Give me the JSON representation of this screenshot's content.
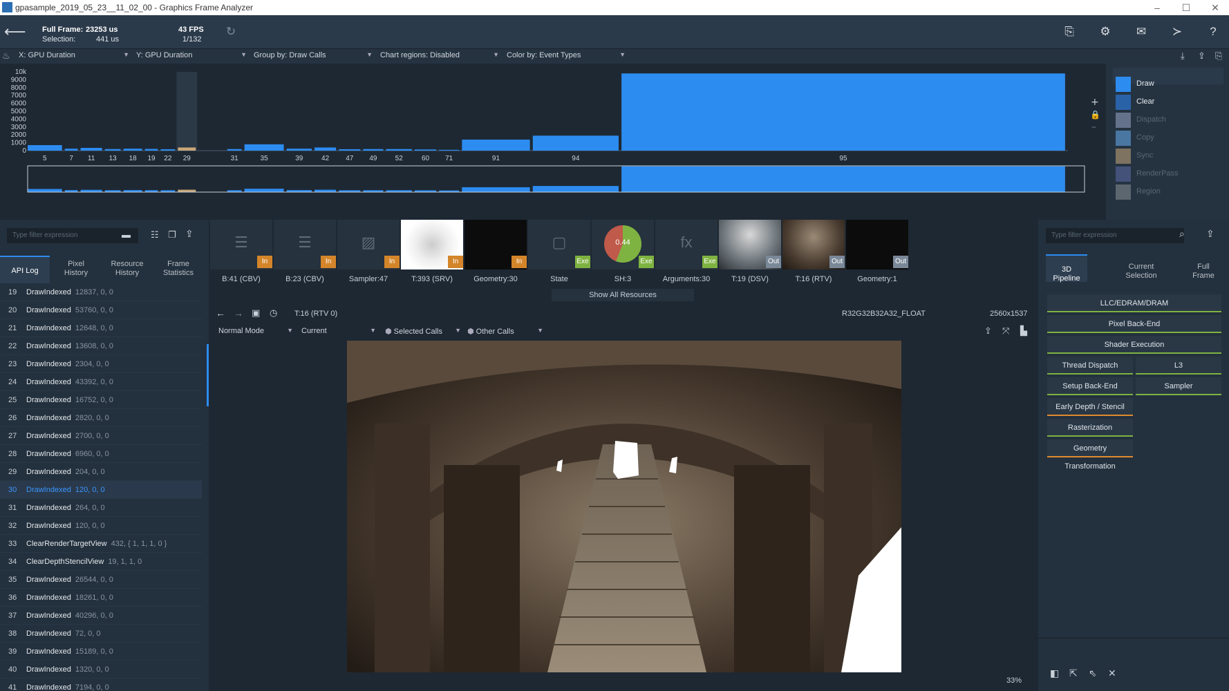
{
  "window": {
    "title": "gpasample_2019_05_23__11_02_00 - Graphics Frame Analyzer",
    "min": "–",
    "max": "☐",
    "close": "✕"
  },
  "toolbar": {
    "full_frame_label": "Full Frame:",
    "full_frame_value": "23253 us",
    "selection_label": "Selection:",
    "selection_value": "441 us",
    "fps": "43 FPS",
    "frame_counter": "1/132"
  },
  "filters": {
    "x_axis": "X: GPU Duration",
    "y_axis": "Y: GPU Duration",
    "group_by": "Group by: Draw Calls",
    "chart_regions": "Chart regions: Disabled",
    "color_by": "Color by: Event Types"
  },
  "chart_data": {
    "type": "bar",
    "ytick_labels": [
      "10k",
      "9000",
      "8000",
      "7000",
      "6000",
      "5000",
      "4000",
      "3000",
      "2000",
      "1000",
      "0"
    ],
    "xtick_labels": [
      "5",
      "7",
      "11",
      "13",
      "18",
      "19",
      "22",
      "29",
      "31",
      "35",
      "39",
      "42",
      "47",
      "49",
      "52",
      "60",
      "71",
      "91",
      "94",
      "95"
    ],
    "ylim": [
      0,
      10000
    ],
    "bars": [
      {
        "label": "5",
        "value": 700,
        "selected": false
      },
      {
        "label": "7",
        "value": 250,
        "selected": false
      },
      {
        "label": "11",
        "value": 350,
        "selected": false
      },
      {
        "label": "13",
        "value": 200,
        "selected": false
      },
      {
        "label": "18",
        "value": 250,
        "selected": false
      },
      {
        "label": "19",
        "value": 220,
        "selected": false
      },
      {
        "label": "22",
        "value": 180,
        "selected": false
      },
      {
        "label": "29",
        "value": 400,
        "selected": true
      },
      {
        "label": "31",
        "value": 200,
        "selected": false
      },
      {
        "label": "35",
        "value": 800,
        "selected": false
      },
      {
        "label": "39",
        "value": 250,
        "selected": false
      },
      {
        "label": "42",
        "value": 400,
        "selected": false
      },
      {
        "label": "47",
        "value": 180,
        "selected": false
      },
      {
        "label": "49",
        "value": 200,
        "selected": false
      },
      {
        "label": "52",
        "value": 200,
        "selected": false
      },
      {
        "label": "60",
        "value": 150,
        "selected": false
      },
      {
        "label": "71",
        "value": 100,
        "selected": false
      },
      {
        "label": "91",
        "value": 1400,
        "selected": false
      },
      {
        "label": "94",
        "value": 1900,
        "selected": false
      },
      {
        "label": "95",
        "value": 9800,
        "selected": false
      }
    ]
  },
  "legend": [
    {
      "label": "Draw",
      "color": "#2d8cf0",
      "dim": false
    },
    {
      "label": "Clear",
      "color": "#2a62a8",
      "dim": false
    },
    {
      "label": "Dispatch",
      "color": "#9aa6c8",
      "dim": true
    },
    {
      "label": "Copy",
      "color": "#6aaef0",
      "dim": true
    },
    {
      "label": "Sync",
      "color": "#c9a77a",
      "dim": true
    },
    {
      "label": "RenderPass",
      "color": "#5e6aa8",
      "dim": true
    },
    {
      "label": "Region",
      "color": "#8a8f96",
      "dim": true
    }
  ],
  "left_panel": {
    "search_placeholder": "Type filter expression",
    "tabs": [
      "API Log",
      "Pixel\nHistory",
      "Resource\nHistory",
      "Frame\nStatistics"
    ],
    "rows": [
      {
        "n": "19",
        "fn": "DrawIndexed",
        "args": "12837, 0, 0"
      },
      {
        "n": "20",
        "fn": "DrawIndexed",
        "args": "53760, 0, 0"
      },
      {
        "n": "21",
        "fn": "DrawIndexed",
        "args": "12648, 0, 0"
      },
      {
        "n": "22",
        "fn": "DrawIndexed",
        "args": "13608, 0, 0"
      },
      {
        "n": "23",
        "fn": "DrawIndexed",
        "args": "2304, 0, 0"
      },
      {
        "n": "24",
        "fn": "DrawIndexed",
        "args": "43392, 0, 0"
      },
      {
        "n": "25",
        "fn": "DrawIndexed",
        "args": "16752, 0, 0"
      },
      {
        "n": "26",
        "fn": "DrawIndexed",
        "args": "2820, 0, 0"
      },
      {
        "n": "27",
        "fn": "DrawIndexed",
        "args": "2700, 0, 0"
      },
      {
        "n": "28",
        "fn": "DrawIndexed",
        "args": "6960, 0, 0"
      },
      {
        "n": "29",
        "fn": "DrawIndexed",
        "args": "204, 0, 0"
      },
      {
        "n": "30",
        "fn": "DrawIndexed",
        "args": "120, 0, 0"
      },
      {
        "n": "31",
        "fn": "DrawIndexed",
        "args": "264, 0, 0"
      },
      {
        "n": "32",
        "fn": "DrawIndexed",
        "args": "120, 0, 0"
      },
      {
        "n": "33",
        "fn": "ClearRenderTargetView",
        "args": "432, { 1, 1, 1, 0 }"
      },
      {
        "n": "34",
        "fn": "ClearDepthStencilView",
        "args": "19, 1, 1, 0"
      },
      {
        "n": "35",
        "fn": "DrawIndexed",
        "args": "26544, 0, 0"
      },
      {
        "n": "36",
        "fn": "DrawIndexed",
        "args": "18261, 0, 0"
      },
      {
        "n": "37",
        "fn": "DrawIndexed",
        "args": "40296, 0, 0"
      },
      {
        "n": "38",
        "fn": "DrawIndexed",
        "args": "72, 0, 0"
      },
      {
        "n": "39",
        "fn": "DrawIndexed",
        "args": "15189, 0, 0"
      },
      {
        "n": "40",
        "fn": "DrawIndexed",
        "args": "1320, 0, 0"
      },
      {
        "n": "41",
        "fn": "DrawIndexed",
        "args": "7194, 0, 0"
      }
    ],
    "selected_row": "30"
  },
  "resources": [
    {
      "cap": "B:41 (CBV)",
      "badge": "In",
      "kind": "buffer"
    },
    {
      "cap": "B:23 (CBV)",
      "badge": "In",
      "kind": "buffer"
    },
    {
      "cap": "Sampler:47",
      "badge": "In",
      "kind": "image"
    },
    {
      "cap": "T:393 (SRV)",
      "badge": "In",
      "kind": "noise"
    },
    {
      "cap": "Geometry:30",
      "badge": "In",
      "kind": "dark"
    },
    {
      "cap": "State",
      "badge": "Exe",
      "kind": "state"
    },
    {
      "cap": "SH:3",
      "badge": "Exe",
      "kind": "pie",
      "pie_value": "0.44"
    },
    {
      "cap": "Arguments:30",
      "badge": "Exe",
      "kind": "fx"
    },
    {
      "cap": "T:19 (DSV)",
      "badge": "Out",
      "kind": "scene1"
    },
    {
      "cap": "T:16 (RTV)",
      "badge": "Out",
      "kind": "scene2"
    },
    {
      "cap": "Geometry:1",
      "badge": "Out",
      "kind": "dark"
    }
  ],
  "show_all": "Show All Resources",
  "viewer": {
    "target": "T:16 (RTV 0)",
    "format": "R32G32B32A32_FLOAT",
    "size": "2560x1537",
    "mode": "Normal Mode",
    "current": "Current",
    "selected_calls": "Selected Calls",
    "other_calls": "Other Calls",
    "zoom": "33%"
  },
  "right_panel": {
    "search_placeholder": "Type filter expression",
    "tabs": [
      "3D\nPipeline",
      "Current\nSelection",
      "Full\nFrame"
    ],
    "pipeline": {
      "llc": "LLC/EDRAM/DRAM",
      "pixel_backend": "Pixel Back-End",
      "shader_exec": "Shader Execution",
      "thread_dispatch": "Thread Dispatch",
      "l3": "L3",
      "setup_backend": "Setup Back-End",
      "sampler": "Sampler",
      "early_depth": "Early Depth / Stencil",
      "raster": "Rasterization",
      "geometry": "Geometry Transformation"
    }
  }
}
